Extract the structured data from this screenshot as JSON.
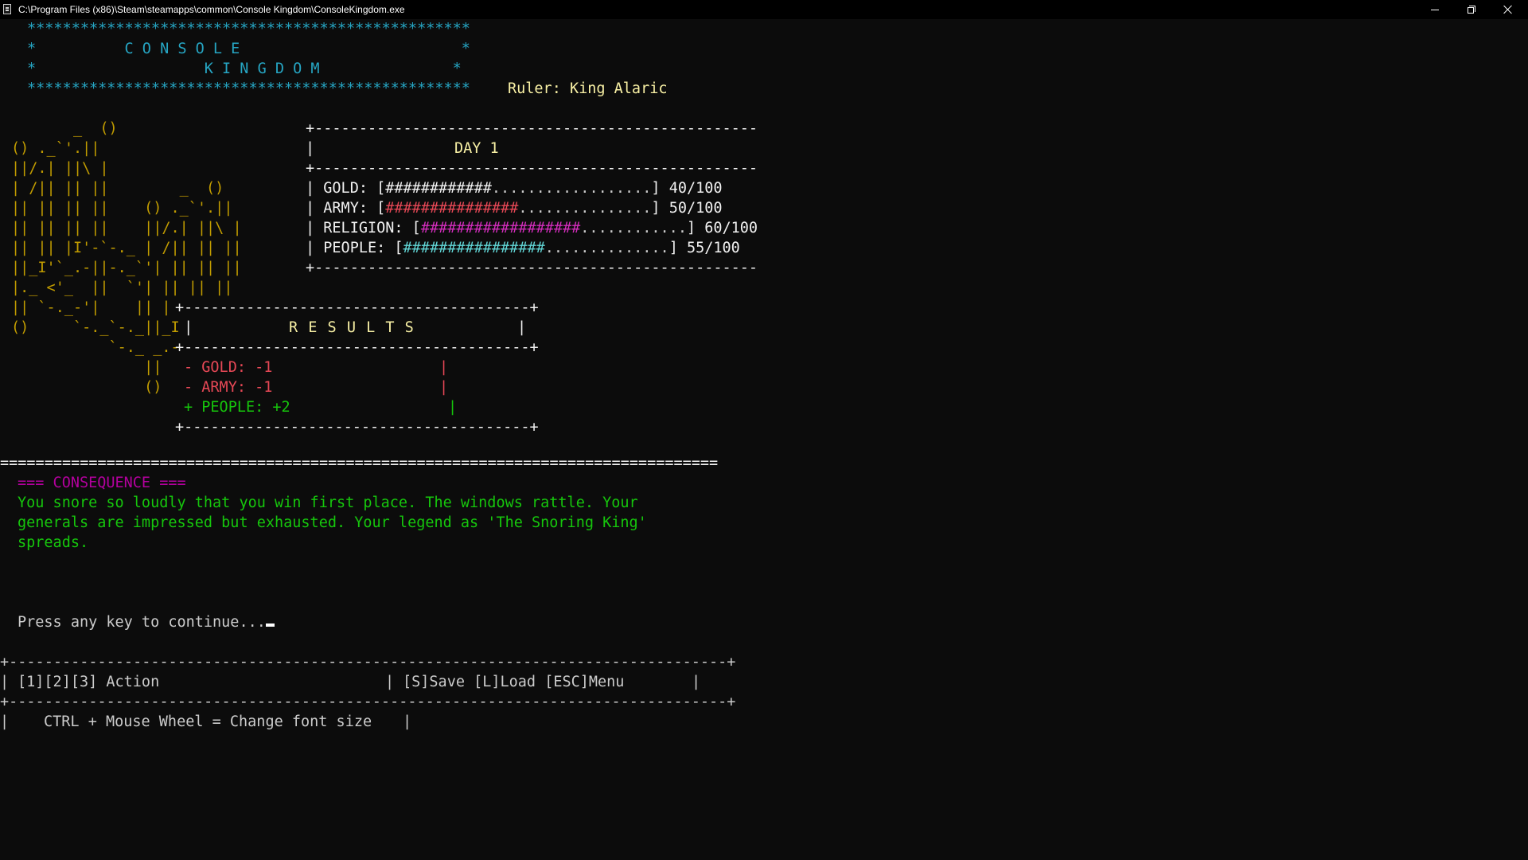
{
  "window": {
    "title": "C:\\Program Files (x86)\\Steam\\steamapps\\common\\Console Kingdom\\ConsoleKingdom.exe"
  },
  "header": {
    "stars_line": "**************************************************",
    "line_console": "*          C O N S O L E                         *",
    "line_kingdom": "*                   K I N G D O M               *",
    "ruler": "Ruler: King Alaric"
  },
  "castle_art": [
    "       _  ()",
    "() ._`'.||",
    "||/.| ||\\ |",
    "| /|| || ||        _  ()",
    "|| || || ||    () ._`'.||",
    "|| || || ||    ||/.| ||\\ |",
    "|| || |I'-`-._ | /|| || ||",
    "||_I'`_.-||-._`'| || || ||",
    "|._ <'_  ||  `'| || || ||",
    "|| `-._-'|    || |",
    "()     `-._`-._||_I",
    "           `-._ _.-",
    "               ||",
    "               ()"
  ],
  "status": {
    "border": "+--------------------------------------------------",
    "day_label": "DAY 1",
    "stats": [
      {
        "label": "GOLD:",
        "filled": "############",
        "empty": "..................",
        "value": "40/100",
        "color": "#f2f2f2"
      },
      {
        "label": "ARMY:",
        "filled": "###############",
        "empty": "...............",
        "value": "50/100",
        "color": "#e74856"
      },
      {
        "label": "RELIGION:",
        "filled": "##################",
        "empty": "............",
        "value": "60/100",
        "color": "#b4009e"
      },
      {
        "label": "PEOPLE:",
        "filled": "################",
        "empty": "..............",
        "value": "55/100",
        "color": "#3a96dd"
      }
    ]
  },
  "results": {
    "border": "+---------------------------------------+",
    "title": "R E S U L T S",
    "items": [
      {
        "text": "- GOLD: -1",
        "color": "#e74856"
      },
      {
        "text": "- ARMY: -1",
        "color": "#e74856"
      },
      {
        "text": "+ PEOPLE: +2",
        "color": "#16c60c"
      }
    ]
  },
  "separator": "=================================================================================",
  "consequence": {
    "heading": "=== CONSEQUENCE ===",
    "lines": [
      "You snore so loudly that you win first place. The windows rattle. Your",
      "generals are impressed but exhausted. Your legend as 'The Snoring King'",
      "spreads."
    ]
  },
  "prompt": "Press any key to continue...",
  "footer": {
    "border": "+---------------------------------------------------------------------------------+",
    "actions": "[1][2][3] Action",
    "shortcuts": "[S]Save [L]Load [ESC]Menu",
    "hint": "CTRL + Mouse Wheel = Change font size"
  },
  "colors": {
    "background": "#0c0c0c",
    "header": "#3a96dd",
    "ruler": "#f9f1a5",
    "castle": "#c19c00",
    "consequence_heading": "#b4009e",
    "consequence_text": "#16c60c"
  }
}
